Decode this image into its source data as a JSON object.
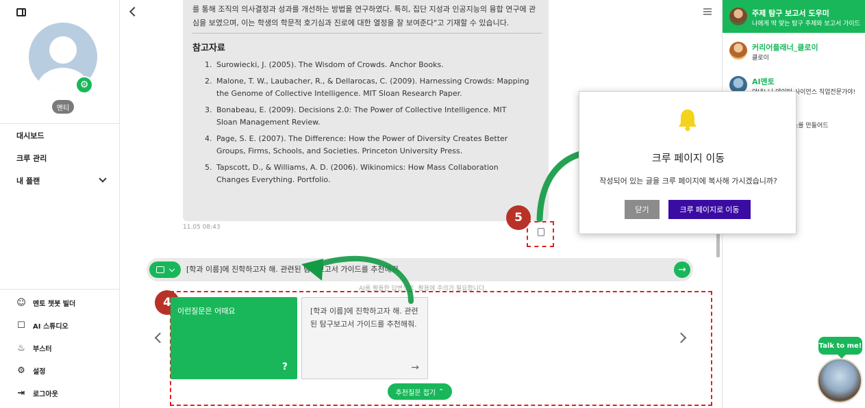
{
  "sidebar": {
    "role_badge": "멘티",
    "nav": [
      {
        "label": "대시보드"
      },
      {
        "label": "크루 관리"
      },
      {
        "label": "내 플랜"
      }
    ],
    "tools": [
      {
        "label": "멘토 챗봇 빌더",
        "icon": "robot-icon"
      },
      {
        "label": "AI 스튜디오",
        "icon": "square-icon"
      },
      {
        "label": "부스터",
        "icon": "fire-icon"
      },
      {
        "label": "설정",
        "icon": "gear-icon"
      },
      {
        "label": "로그아웃",
        "icon": "logout-icon"
      }
    ]
  },
  "message": {
    "text": "학교생활기록부에 위 탐구보고서의 내용을 기재한다면, \"학생은 정량적의 핵심 개념인 집단 지성을 탐구하고, 이를 통해 조직의 의사결정과 성과를 개선하는 방법을 연구하였다. 특히, 집단 지성과 인공지능의 융합 연구에 관심을 보였으며, 이는 학생의 학문적 호기심과 진로에 대한 열정을 잘 보여준다\"고 기재할 수 있습니다.",
    "references_title": "참고자료",
    "references": [
      "Surowiecki, J. (2005). The Wisdom of Crowds. Anchor Books.",
      "Malone, T. W., Laubacher, R., & Dellarocas, C. (2009). Harnessing Crowds: Mapping the Genome of Collective Intelligence. MIT Sloan Research Paper.",
      "Bonabeau, E. (2009). Decisions 2.0: The Power of Collective Intelligence. MIT Sloan Management Review.",
      "Page, S. E. (2007). The Difference: How the Power of Diversity Creates Better Groups, Firms, Schools, and Societies. Princeton University Press.",
      "Tapscott, D., & Williams, A. D. (2006). Wikinomics: How Mass Collaboration Changes Everything. Portfolio."
    ],
    "timestamp": "11.05 08:43"
  },
  "annotations": {
    "step4": "4",
    "step5": "5"
  },
  "chat": {
    "input_value": "[학과 이름]에 진학하고자 해. 관련된 탐구보고서 가이드를 추천해줘.",
    "disclaimer": "AI를 활용한 답변으로, 활용에 주의가 필요합니다."
  },
  "suggestions": {
    "card_green": {
      "label": "이런질문은 어때요",
      "icon": "?"
    },
    "card_gray": {
      "label": "[학과 이름]에 진학하고자 해. 관련된 탐구보고서 가이드를 추천해줘."
    },
    "collapse_label": "추천질문 접기"
  },
  "right_panel": {
    "entries": [
      {
        "title": "주제 탐구 보고서 도우미",
        "subtitle": "나에게 딱 맞는 탐구 주제와 보고서 가이드"
      },
      {
        "title": "커리어플래너_클로이",
        "subtitle": "클로이"
      },
      {
        "title": "AI멘토",
        "subtitle": "안녕! 나 데이터 사이언스 직업전문가야!"
      },
      {
        "title": "",
        "subtitle": "고 타입랩스를 만들어드"
      }
    ],
    "talk_label": "Talk to me!"
  },
  "modal": {
    "title": "크루 페이지 이동",
    "message": "작성되어 있는 글을 크루 페이지에 복사해 가시겠습니까?",
    "close_label": "닫기",
    "confirm_label": "크루 페이지로 이동"
  },
  "colors": {
    "accent": "#19b75a",
    "confirm": "#3a0ca3",
    "annotation": "#e01f1f",
    "badge": "#b83227"
  }
}
